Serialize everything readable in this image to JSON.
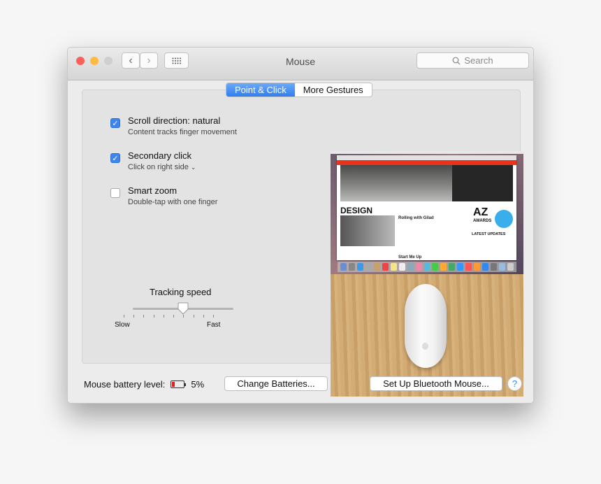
{
  "window": {
    "title": "Mouse",
    "search_placeholder": "Search"
  },
  "tabs": [
    {
      "label": "Point & Click",
      "active": true
    },
    {
      "label": "More Gestures",
      "active": false
    }
  ],
  "options": [
    {
      "title": "Scroll direction: natural",
      "subtitle": "Content tracks finger movement",
      "checked": true
    },
    {
      "title": "Secondary click",
      "subtitle": "Click on right side",
      "checked": true,
      "has_dropdown": true
    },
    {
      "title": "Smart zoom",
      "subtitle": "Double-tap with one finger",
      "checked": false
    }
  ],
  "tracking": {
    "label": "Tracking speed",
    "min_label": "Slow",
    "max_label": "Fast",
    "value_fraction": 0.667,
    "tick_count": 10
  },
  "preview": {
    "heading": "DESIGN",
    "article1": "Rolling with Gilad",
    "article2": "Start Me Up",
    "sidebar_heading": "LATEST UPDATES",
    "logo_az": "AZ",
    "logo_awards": "AWARDS"
  },
  "footer": {
    "battery_label": "Mouse battery level:",
    "battery_value": "5%",
    "battery_percent": 5,
    "change_batteries": "Change Batteries...",
    "setup_bluetooth": "Set Up Bluetooth Mouse...",
    "help": "?"
  },
  "colors": {
    "accent": "#3b86f2",
    "battery_low": "#e02020",
    "close": "#fc605c",
    "minimize": "#fdbc40",
    "zoom_disabled": "#cfcfcf"
  }
}
